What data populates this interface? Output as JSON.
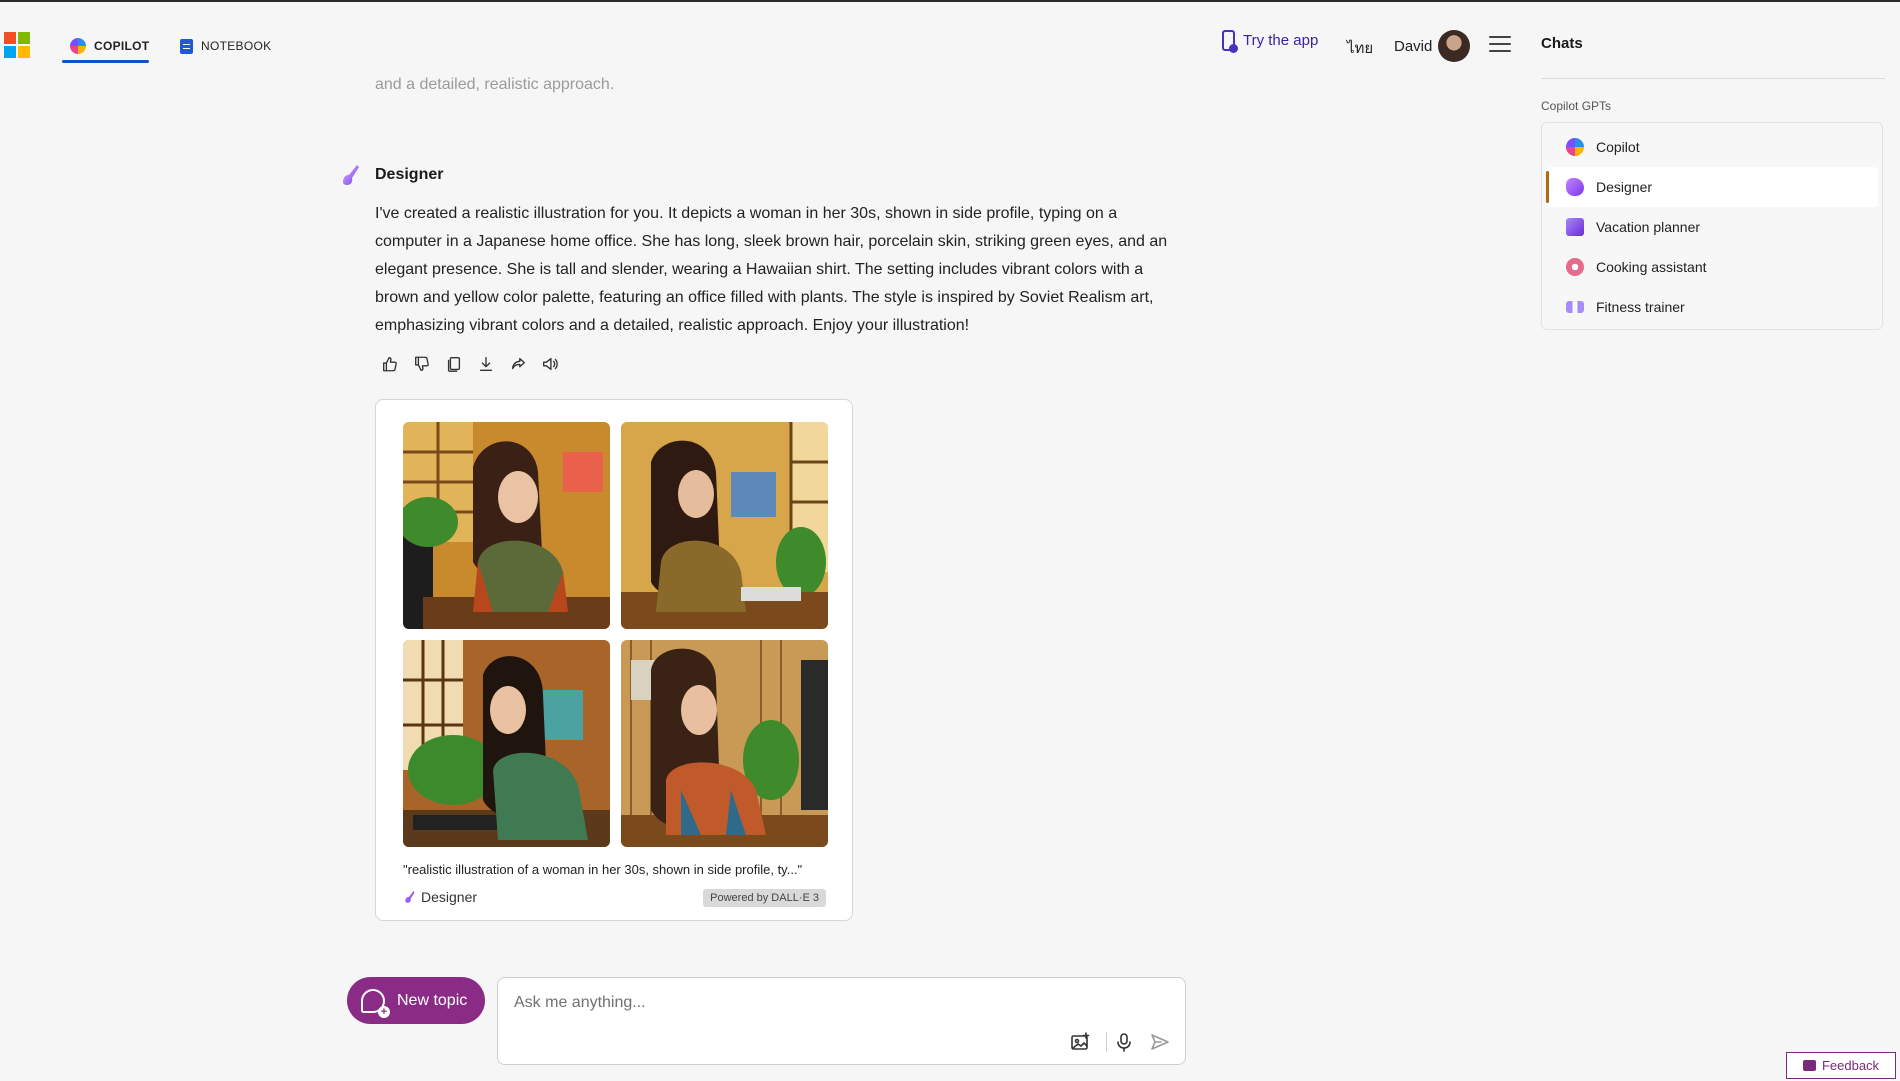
{
  "nav": {
    "tabs": [
      {
        "label": "COPILOT",
        "icon": "copilot-icon",
        "active": true
      },
      {
        "label": "NOTEBOOK",
        "icon": "notebook-icon",
        "active": false
      }
    ],
    "try_app": "Try the app",
    "language": "ไทย",
    "user_name": "David"
  },
  "sidebar": {
    "title": "Chats",
    "section_label": "Copilot GPTs",
    "items": [
      {
        "label": "Copilot",
        "icon": "copilot-icon"
      },
      {
        "label": "Designer",
        "icon": "designer-icon",
        "selected": true
      },
      {
        "label": "Vacation planner",
        "icon": "suitcase-icon"
      },
      {
        "label": "Cooking assistant",
        "icon": "donut-icon"
      },
      {
        "label": "Fitness trainer",
        "icon": "dumbbell-icon"
      }
    ]
  },
  "conversation": {
    "previous_text_tail": "and a detailed, realistic approach.",
    "sender": "Designer",
    "message": "I've created a realistic illustration for you. It depicts a woman in her 30s, shown in side profile, typing on a computer in a Japanese home office. She has long, sleek brown hair, porcelain skin, striking green eyes, and an elegant presence. She is tall and slender, wearing a Hawaiian shirt. The setting includes vibrant colors with a brown and yellow color palette, featuring an office filled with plants. The style is inspired by Soviet Realism art, emphasizing vibrant colors and a detailed, realistic approach. Enjoy your illustration!",
    "actions": [
      "thumbs-up-icon",
      "thumbs-down-icon",
      "copy-icon",
      "download-icon",
      "share-icon",
      "read-aloud-icon"
    ]
  },
  "image_card": {
    "caption": "\"realistic illustration of a woman in her 30s, shown in side profile, ty...\"",
    "source": "Designer",
    "powered_by": "Powered by DALL·E 3",
    "image_count": 4
  },
  "composer": {
    "new_topic": "New topic",
    "placeholder": "Ask me anything..."
  },
  "feedback": "Feedback",
  "colors": {
    "accent": "#1550c9",
    "new_topic_bg": "#8a2c86",
    "try_app_text": "#3b1fa5"
  }
}
